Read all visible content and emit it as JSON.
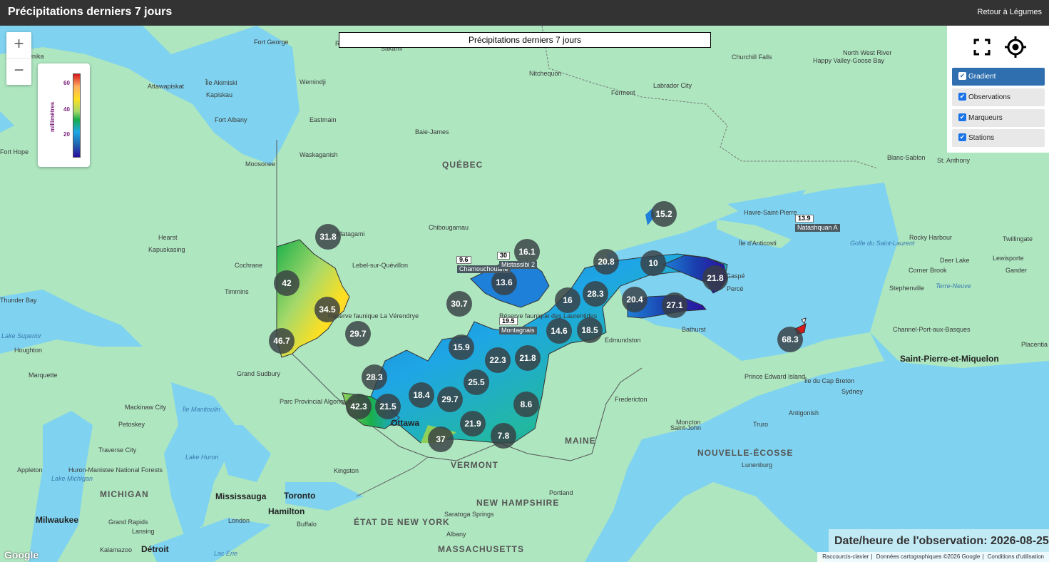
{
  "header": {
    "title": "Précipitations derniers 7 jours",
    "back_link": "Retour à Légumes"
  },
  "map_title": "Précipitations derniers 7 jours",
  "zoom": {
    "in": "+",
    "out": "−"
  },
  "legend": {
    "unit": "millimètres",
    "ticks": [
      "60",
      "40",
      "20"
    ]
  },
  "controls": {
    "fullscreen_icon": "fullscreen-icon",
    "locate_icon": "crosshair-icon"
  },
  "layers": [
    {
      "label": "Gradient",
      "checked": true,
      "active": true
    },
    {
      "label": "Observations",
      "checked": true,
      "active": false
    },
    {
      "label": "Marqueurs",
      "checked": true,
      "active": false
    },
    {
      "label": "Stations",
      "checked": true,
      "active": false
    }
  ],
  "markers": [
    "31.8",
    "16.1",
    "15.2",
    "20.8",
    "10",
    "21.8",
    "42",
    "13.6",
    "28.3",
    "20.4",
    "27.1",
    "34.5",
    "30.7",
    "16",
    "14.6",
    "18.5",
    "46.7",
    "29.7",
    "15.9",
    "22.3",
    "21.8",
    "68.3",
    "28.3",
    "25.5",
    "18.4",
    "29.7",
    "42.3",
    "21.5",
    "8.6",
    "21.9",
    "37",
    "7.8"
  ],
  "stations": [
    {
      "name": "Chamouchouane",
      "value": "9.6"
    },
    {
      "name": "Mistassibi 2",
      "value": "30"
    },
    {
      "name": "Montagnais",
      "value": "19.5"
    },
    {
      "name": "Natashquan A",
      "value": "13.9"
    }
  ],
  "places": [
    "Fort George",
    "Radisson",
    "Sakami",
    "Churchill Falls",
    "Happy Valley-Goose Bay",
    "North West River",
    "Onika",
    "Attawapiskat",
    "Île Akimiski",
    "Kapiskau",
    "Wemindji",
    "Nitchequon",
    "Fermont",
    "Labrador City",
    "Fort Albany",
    "Eastmain",
    "Baie-James",
    "Fort Hope",
    "Moosonee",
    "Waskaganish",
    "QUÉBEC",
    "Blanc-Sablon",
    "St. Anthony",
    "Havre-Saint-Pierre",
    "Île d'Anticosti",
    "Hearst",
    "Matagami",
    "Chibougamau",
    "Kapuskasing",
    "Cochrane",
    "Lebel-sur-Quévillon",
    "Timmins",
    "Rocky Harbour",
    "Twillingate",
    "Deer Lake",
    "Lewisporte",
    "Corner Brook",
    "Gander",
    "Stephenville",
    "Terre-Neuve",
    "Channel-Port-aux-Basques",
    "Saint-Pierre-et-Miquelon",
    "Placentia",
    "Percé",
    "Gaspé",
    "Bathurst",
    "Edmundston",
    "Houghton",
    "Marquette",
    "Grand Sudbury",
    "Parc Provincial Algonquin",
    "Ottawa",
    "Île Manitoulin",
    "Mackinaw City",
    "Petoskey",
    "Traverse City",
    "Huron-Manistee National Forests",
    "MICHIGAN",
    "Kingston",
    "VERMONT",
    "MAINE",
    "Fredericton",
    "Moncton",
    "Prince Edward Island",
    "Île du Cap Breton",
    "Sydney",
    "Antigonish",
    "Truro",
    "Saint-John",
    "NOUVELLE-ÉCOSSE",
    "Lunenburg",
    "Mississauga",
    "Toronto",
    "Hamilton",
    "Milwaukee",
    "Grand Rapids",
    "Lansing",
    "London",
    "Buffalo",
    "ÉTAT DE NEW YORK",
    "Kalamazoo",
    "Détroit",
    "NEW HAMPSHIRE",
    "Portland",
    "Saratoga Springs",
    "Albany",
    "MASSACHUSETTS",
    "Appleton",
    "Golfe du Saint-Laurent",
    "Lake Superior",
    "Thunder Bay",
    "Lake Huron",
    "Lake Michigan",
    "Lac Erie",
    "Réserve faunique La Vérendrye",
    "Réserve faunique des Laurentides"
  ],
  "observation_time": {
    "label": "Date/heure de l'observation:",
    "value": "2026-08-25"
  },
  "attribution": [
    "Raccourcis-clavier",
    "Données cartographiques ©2026 Google",
    "Conditions d'utilisation"
  ],
  "google_logo": "Google"
}
